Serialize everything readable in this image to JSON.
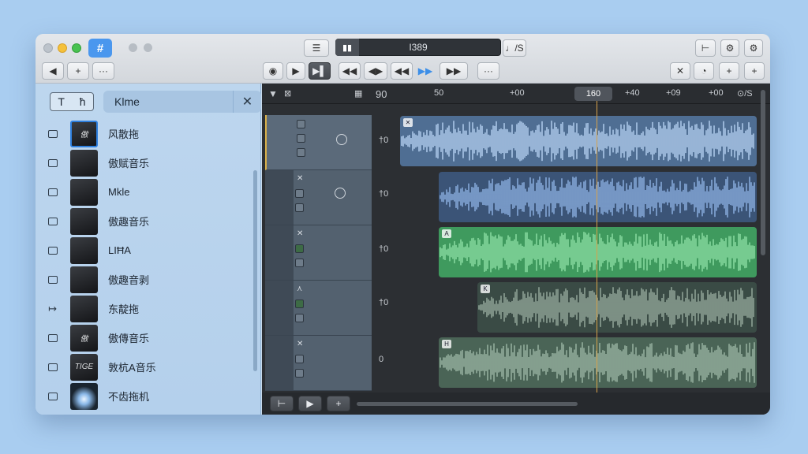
{
  "toolbar": {
    "hash_label": "#",
    "left_buttons": [
      "◀",
      "+",
      "···"
    ],
    "list_button": "☰",
    "lcd_text": "I389",
    "lcd_suffix": "♩/S",
    "transport": [
      "◉",
      "▶",
      "▶▌",
      "◀◀",
      "◀▶",
      "◀◀",
      "▶▶",
      "▶▶",
      "···"
    ],
    "right_top": [
      "⊢",
      "⚙",
      "⚙"
    ],
    "right_bottom": [
      "✕",
      "◔",
      "+",
      "+"
    ]
  },
  "sidebar": {
    "toggle_t": "T",
    "toggle_h": "ħ",
    "search_value": "Klme",
    "clear_label": "✕",
    "items": [
      {
        "thumb": "傲",
        "label": "风散拖",
        "marker": "box"
      },
      {
        "thumb": "",
        "label": "傲赋音乐",
        "marker": "box"
      },
      {
        "thumb": "",
        "label": "Mkle",
        "marker": "box"
      },
      {
        "thumb": "",
        "label": "傲趣音乐",
        "marker": "box"
      },
      {
        "thumb": "",
        "label": "LIĦA",
        "marker": "box"
      },
      {
        "thumb": "",
        "label": "傲趣音剥",
        "marker": "box"
      },
      {
        "thumb": "",
        "label": "东靛拖",
        "marker": "arrow"
      },
      {
        "thumb": "傲",
        "label": "傲傳音乐",
        "marker": "box"
      },
      {
        "thumb": "TIGE",
        "label": "敦杭A音乐",
        "marker": "box"
      },
      {
        "thumb": "",
        "label": "不齿拖机",
        "marker": "box"
      }
    ]
  },
  "ruler": {
    "labels": [
      "90",
      "50",
      "+00",
      "+40",
      "+09",
      "+00",
      "⊙/S"
    ],
    "playhead": "160"
  },
  "tracks": [
    {
      "vol": "†0",
      "color": "#4f6e93",
      "wave": "#b7d3f2"
    },
    {
      "vol": "†0",
      "color": "#3b5477",
      "wave": "#8fb4e6"
    },
    {
      "vol": "†0",
      "color": "#3f9a5e",
      "wave": "#8fe0a6"
    },
    {
      "vol": "†0",
      "color": "#3a4b45",
      "wave": "#98ad9f"
    },
    {
      "vol": "0",
      "color": "#4a6456",
      "wave": "#9db8a6"
    }
  ]
}
